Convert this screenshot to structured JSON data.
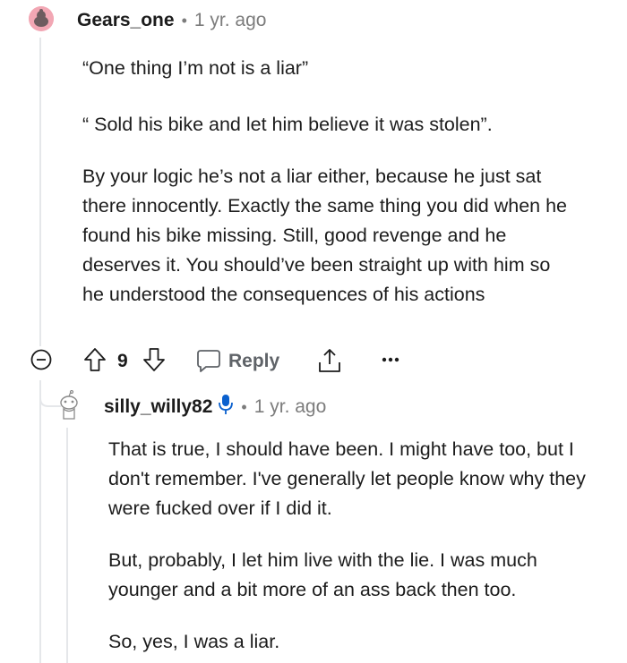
{
  "comment": {
    "username": "Gears_one",
    "time": "1 yr. ago",
    "paragraphs": [
      "“One thing I’m not is a liar”",
      "“ Sold his bike and let him believe it was stolen”.",
      "By your logic he’s not a liar either, because he just sat there innocently. Exactly the same thing you did when he found his bike missing. Still, good revenge and he deserves it. You should’ve been straight up with him so he understood the consequences of his actions"
    ],
    "actions": {
      "vote_count": "9",
      "reply_label": "Reply"
    },
    "icons": [
      "collapse-icon",
      "upvote-icon",
      "downvote-icon",
      "reply-bubble-icon",
      "share-icon",
      "more-icon"
    ]
  },
  "reply": {
    "username": "silly_willy82",
    "time": "1 yr. ago",
    "paragraphs": [
      "That is true, I should have been. I might have too, but I don't remember. I've generally let people know why they were fucked over if I did it.",
      "But, probably, I let him live with the lie. I was much younger and a bit more of an ass back then too.",
      "So, yes, I was a liar."
    ],
    "icons": [
      "snoo-avatar-icon",
      "microphone-icon"
    ]
  },
  "colors": {
    "accent_blue": "#0a60ce",
    "meta_gray": "#7c7c7c",
    "avatar_pink": "#f2a7b4"
  }
}
